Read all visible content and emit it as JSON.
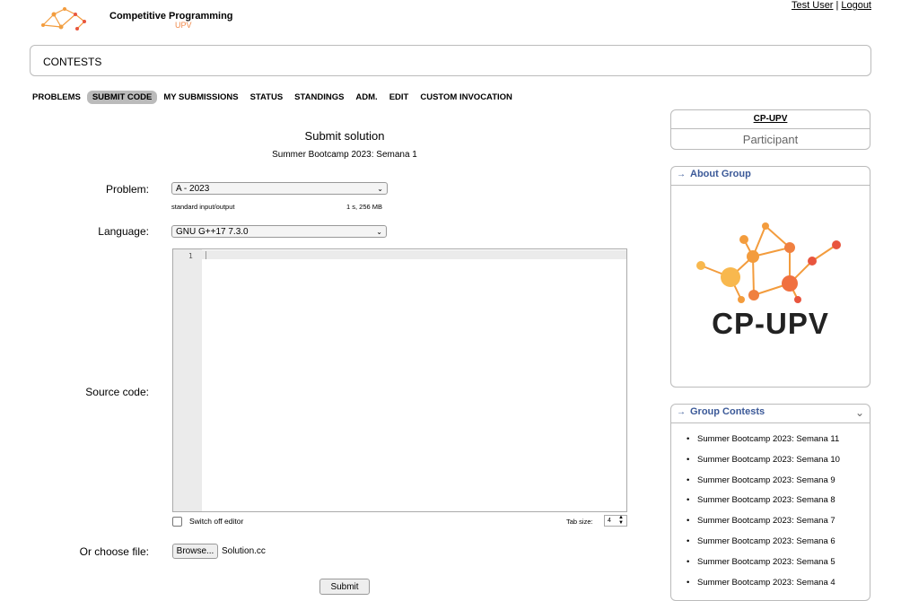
{
  "header": {
    "logo_title": "Competitive Programming",
    "logo_sub": "UPV",
    "user_name": "Test User",
    "logout": "Logout",
    "separator": "|"
  },
  "contests_bar": "CONTESTS",
  "menu": [
    "PROBLEMS",
    "SUBMIT CODE",
    "MY SUBMISSIONS",
    "STATUS",
    "STANDINGS",
    "ADM.",
    "EDIT",
    "CUSTOM INVOCATION"
  ],
  "menu_active": "SUBMIT CODE",
  "form": {
    "title": "Submit solution",
    "contest": "Summer Bootcamp 2023: Semana 1",
    "problem_label": "Problem:",
    "problem_value": "A - 2023",
    "io_info": "standard input/output",
    "limits": "1 s, 256 MB",
    "language_label": "Language:",
    "language_value": "GNU G++17 7.3.0",
    "source_label": "Source code:",
    "line_number": "1",
    "switch_editor": "Switch off editor",
    "tab_size_label": "Tab size:",
    "tab_size_value": "4",
    "file_label": "Or choose file:",
    "browse": "Browse...",
    "file_name": "Solution.cc",
    "submit": "Submit"
  },
  "sidebar": {
    "group_name": "CP-UPV",
    "role": "Participant",
    "about_title": "About Group",
    "logo_text": "CP-UPV",
    "contests_title": "Group Contests",
    "contests": [
      "Summer Bootcamp 2023: Semana 11",
      "Summer Bootcamp 2023: Semana 10",
      "Summer Bootcamp 2023: Semana 9",
      "Summer Bootcamp 2023: Semana 8",
      "Summer Bootcamp 2023: Semana 7",
      "Summer Bootcamp 2023: Semana 6",
      "Summer Bootcamp 2023: Semana 5",
      "Summer Bootcamp 2023: Semana 4"
    ]
  },
  "colors": {
    "accent": "#3b5998",
    "logo_orange": "#f39c3d",
    "logo_red": "#e8553e"
  }
}
